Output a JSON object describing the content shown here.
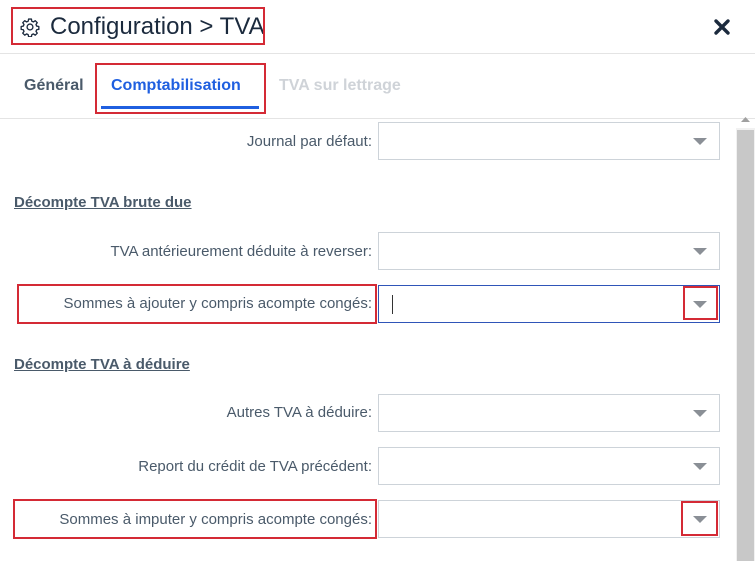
{
  "window": {
    "title": "Configuration > TVA",
    "title_icon": "gear-icon",
    "close_icon": "close-icon"
  },
  "tabs": [
    {
      "label": "Général",
      "state": "inactive"
    },
    {
      "label": "Comptabilisation",
      "state": "active"
    },
    {
      "label": "TVA sur lettrage",
      "state": "disabled"
    }
  ],
  "form": {
    "journal_label": "Journal par défaut:",
    "section_brute": "Décompte TVA brute due",
    "tva_anterieure_label": "TVA antérieurement déduite à reverser:",
    "sommes_ajouter_label": "Sommes à ajouter y compris acompte congés:",
    "section_deduire": "Décompte TVA à déduire",
    "autres_tva_label": "Autres TVA à déduire:",
    "report_credit_label": "Report du crédit de TVA précédent:",
    "sommes_imputer_label": "Sommes à imputer y compris acompte congés:"
  },
  "colors": {
    "accent": "#1f5fe0",
    "highlight": "#d42a35",
    "title": "#1b2a3d"
  }
}
